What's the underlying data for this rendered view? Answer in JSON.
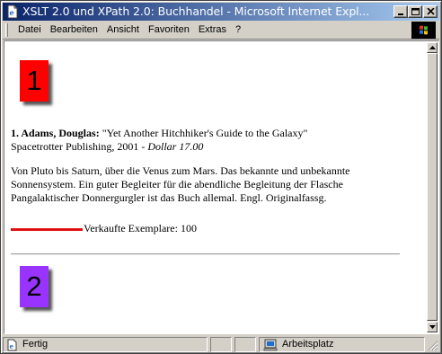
{
  "window": {
    "title": "XSLT 2.0 und XPath 2.0: Buchhandel - Microsoft Internet Expl..."
  },
  "menu": {
    "items": [
      "Datei",
      "Bearbeiten",
      "Ansicht",
      "Favoriten",
      "Extras",
      "?"
    ]
  },
  "content": {
    "marker1": "1",
    "marker2": "2",
    "book": {
      "number_author": "1. Adams, Douglas:",
      "title": "\"Yet Another Hitchhiker's Guide to the Galaxy\"",
      "publisher_year": "Spacetrotter Publishing, 2001 - ",
      "price": "Dollar 17.00",
      "description": "Von Pluto bis Saturn, über die Venus zum Mars. Das bekannte und unbekannte Sonnensystem. Ein guter Begleiter für die abendliche Begleitung der Flasche Pangalaktischer Donnergurgler ist das Buch allemal. Engl. Originalfassg.",
      "sales_label": "Verkaufte Exemplare: 100",
      "sales_bar_color": "#e31010"
    }
  },
  "status": {
    "text": "Fertig",
    "zone": "Arbeitsplatz"
  },
  "icons": {
    "app": "ie-page-icon",
    "minimize": "minimize-icon",
    "maximize": "maximize-icon",
    "close": "close-icon",
    "status": "ie-page-icon",
    "zone": "my-computer-icon"
  },
  "colors": {
    "titlebar_start": "#0a246a",
    "titlebar_end": "#a6caf0",
    "marker1": "#ff0000",
    "marker2": "#9933ff"
  }
}
